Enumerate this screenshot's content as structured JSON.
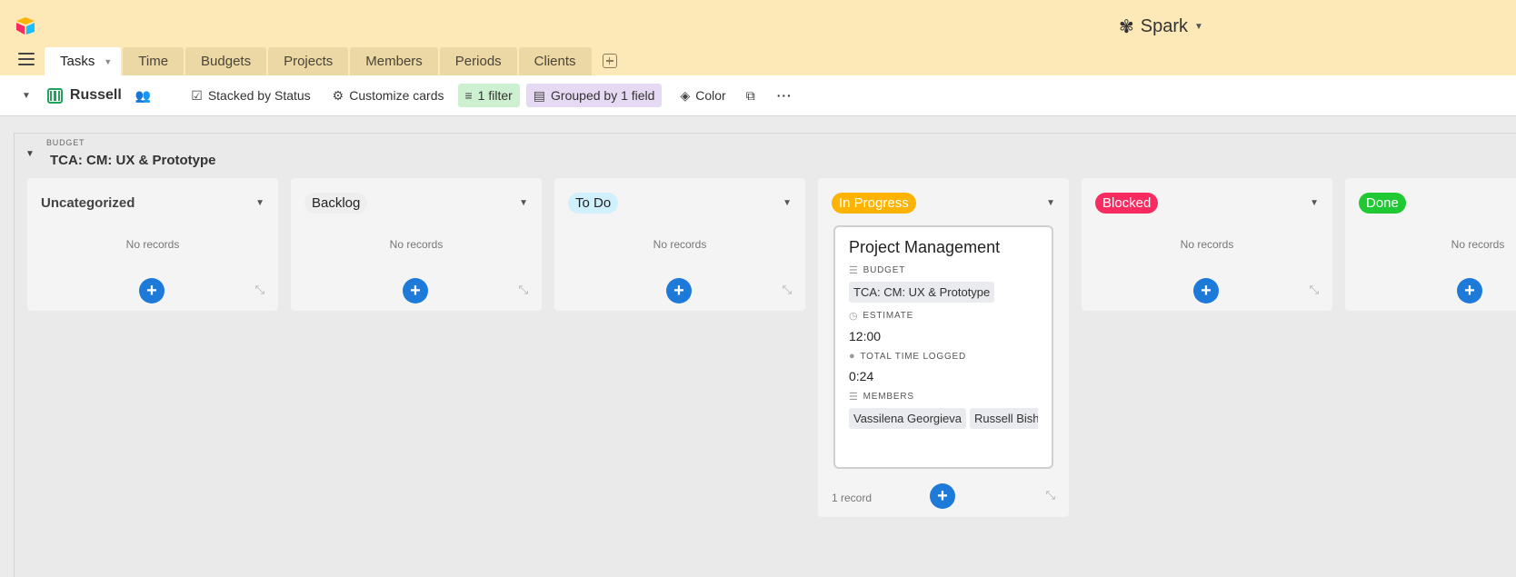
{
  "app": {
    "base_name": "Spark",
    "logo_icon": "airtable-logo-icon"
  },
  "tabs": [
    "Tasks",
    "Time",
    "Budgets",
    "Projects",
    "Members",
    "Periods",
    "Clients"
  ],
  "toolbar": {
    "view_name": "Russell",
    "stacked": "Stacked by Status",
    "customize": "Customize cards",
    "filter": "1 filter",
    "grouped": "Grouped by 1 field",
    "color": "Color"
  },
  "group": {
    "label": "BUDGET",
    "value": "TCA: CM: UX & Prototype"
  },
  "columns": [
    {
      "title": "Uncategorized",
      "empty_text": "No records"
    },
    {
      "title": "Backlog",
      "empty_text": "No records",
      "bg": "#eeeeee"
    },
    {
      "title": "To Do",
      "empty_text": "No records",
      "bg": "#d0f0fd"
    },
    {
      "title": "In Progress",
      "bg": "#fcb400",
      "fg": "#ffffff",
      "count": "1 record"
    },
    {
      "title": "Blocked",
      "empty_text": "No records",
      "bg": "#f82b60",
      "fg": "#ffffff"
    },
    {
      "title": "Done",
      "empty_text": "No records",
      "bg": "#20c933",
      "fg": "#ffffff"
    }
  ],
  "card": {
    "title": "Project Management",
    "budget_label": "BUDGET",
    "budget_value": "TCA: CM: UX & Prototype",
    "estimate_label": "ESTIMATE",
    "estimate_value": "12:00",
    "time_label": "TOTAL TIME LOGGED",
    "time_value": "0:24",
    "members_label": "MEMBERS",
    "members": [
      "Vassilena Georgieva",
      "Russell Bish"
    ]
  },
  "colors": {
    "header_bg": "#fde9b7",
    "accent_blue": "#1d7ad8"
  }
}
